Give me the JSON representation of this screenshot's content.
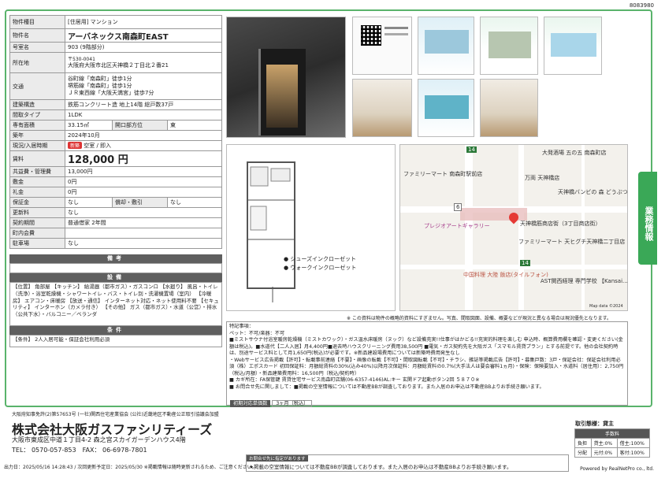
{
  "doc_code": "8083980",
  "spec": {
    "type_label": "物件種目",
    "type_value": "[住居用] マンション",
    "name_label": "物件名",
    "name_value": "アーバネックス南森町EAST",
    "room_label": "号室名",
    "room_value": "903 (9階部分)",
    "addr_label": "所在地",
    "addr_zip": "〒530-0041",
    "addr_value": "大阪府大阪市北区天神橋２丁目北２番21",
    "traffic_label": "交通",
    "traffic": [
      "谷町線「南森町」徒歩1分",
      "堺筋線「南森町」徒歩1分",
      "ＪＲ東西線「大阪天満宮」徒歩7分"
    ],
    "structure_label": "建築構造",
    "structure_value": "鉄筋コンクリート造 地上14階 総戸数37戸",
    "layout_label": "間取タイプ",
    "layout_value": "1LDK",
    "area_label": "専有面積",
    "area_value": "33.15㎡",
    "dir_label": "開口部方位",
    "dir_value": "東",
    "built_label": "築年",
    "built_value": "2024年10月",
    "status_label": "現況/入居時期",
    "status_badge": "新築",
    "status_value": "空室 / 即入",
    "rent_label": "賃料",
    "rent_value": "128,000 円",
    "mgmt_label": "共益費・管理費",
    "mgmt_value": "13,000円",
    "deposit_label": "敷金",
    "deposit_value": "0円",
    "key_label": "礼金",
    "key_value": "0円",
    "guarantee_label": "保証金",
    "guarantee_value": "なし",
    "amort_label": "償却・敷引",
    "amort_value": "なし",
    "renewal_label": "更新料",
    "renewal_value": "なし",
    "contract_label": "契約期間",
    "contract_value": "普通借家 2年間",
    "assoc_label": "町内会費",
    "assoc_value": "",
    "parking_label": "駐車場",
    "parking_value": "なし"
  },
  "sections": {
    "remarks_h": "備考",
    "equip_h": "設備",
    "equip_text": "【位置】 角部屋 【キッチン】 給湯器（都市ガス）・ガスコンロ 【水廻り】 風呂・トイレ（洗浄）・浴室乾燥機・シャワートイレ・バス・トイレ別・洗濯機置場（室内） 【冷暖房】 エアコン・床暖房 【放送・通信】 インターネット対応・ネット使用料不要 【セキュリティ】 インターホン（カメラ付き） 【その他】 ガス（都市ガス）・水道（公営）・排水（公共下水）・バルコニー／ベランダ",
    "cond_h": "条件",
    "cond_text": "【条件】 2人入居可能・保証会社利用必須"
  },
  "floorplan_notes": [
    "● シューズインクローゼット",
    "● ウォークインクローゼット"
  ],
  "map": {
    "labels": [
      "大発酒場 五の五 南森町店",
      "ファミリーマート 南森町駅前店",
      "万両 天神橋店",
      "天神橋バンビの 森 どうぶつ病院",
      "プレジオアートギャラリー",
      "天神橋筋商店街（3丁目商店街）",
      "ファミリーマート 天ヒグチ天神橋二丁目店",
      "中国料理 大陸 飯店(タイルフォン)",
      "AST関西経理 専門学校 【Kansai...",
      "Map data ©2024"
    ],
    "route_numbers": [
      "14",
      "14",
      "6"
    ]
  },
  "side_tab": "業務情報",
  "photo_note": "※ この資料は物件の概略的資料にすぎません。写真、間取図面、設備、概要などが現況と異なる場合は現況優先となります。",
  "remarks_title": "特記事項：",
  "remarks_lines": [
    "ペット：不可/楽器：不可",
    "■ミストサウナ付浴室暖房乾燥機（ミストカワック）・ガス温水床暖房（ヌック）など設備充実!!仕事がはかどる!!充実的料理を楽しむ 申込時、概算費用欄を確認・変更ください(金額は税込)。■水道代【二人入居】月4,400円■退去時ハウスクリーニング費用38,500円 ■電気・ガス契約先を大阪ガス「スマモル賃貸プラン」とする前提です。他の会社契約時は、別途サービス料として月1,650円(税込)が必要です。※新品建設場費用については新築時費用発生なし",
    "・Webサービス広告掲載【許可】・転載事前連絡【不要】・画像の転載【不可】・間取図転載【不可】・チラシ、雑誌等掲載広告【許可】・募集戸数：3戸・保証会社：保証会社利用必須（株）エポスカード 初回保証料：月額総賃料の30%(込み40%)以降月次保証料：月額総賃料の0.7%(大手法人は要会審料1ヵ月)・保険：保険要加入・水道料（居住用）：2,750円（税込/月額）・新品建築費用料：16,500円（税込/契約時）",
    "■ カギ所在：FA保管鍵 賃貸住宅サービス南森町店舗(06-6357-4146)AL:キー 玄関ドア起動ボタン2回 ５８７０※",
    "■ お問合せ先に関しまして：■掲載の空室情報については不動産BBが調査しております。また入居のお申込は不動産BBよりお手続き願います。"
  ],
  "initcost": {
    "label": "初期対応単価数",
    "value": "3ヶ月（税込）"
  },
  "footer": {
    "license": "大阪府知事免許(2)第57653号 (一社)関西住宅産業協会 (公社)近畿地区不動産公正取引協議会加盟",
    "company": "株式会社大阪ガスファシリティーズ",
    "address": "大阪市東成区中道１丁目4-2 森之宮スカイガーデンハウス4階",
    "tel": "TEL： 0570-057-853　FAX： 06-6978-7801",
    "footnote": "出力日：2025/05/16 14:28:43 / 次回更新予定日：2025/05/30 ※掲載情報は随時更新されるため、ご注意ください。",
    "notice_tag": "お問合せ先に指定があります",
    "notice_text": "★掲載の空室情報については不動産BBが調査しております。また入居のお申込は不動産BBよりお手続き願います。",
    "tx_title": "取引態様：貸主",
    "tx_head": "手数料",
    "tx_rows": [
      [
        "負担",
        "貸主:0%",
        "借主:100%"
      ],
      [
        "分配",
        "元付:0%",
        "客付:100%"
      ]
    ],
    "powered": "Powered by RealNetPro co., ltd."
  }
}
